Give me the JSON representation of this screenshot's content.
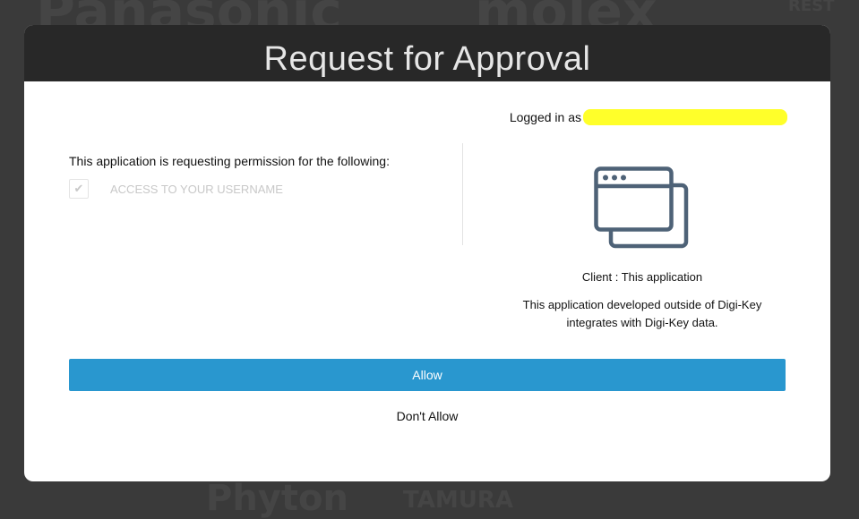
{
  "background_words": [
    "Panasonic",
    "molex",
    "Phyton",
    "TAMURA",
    "REST"
  ],
  "dialog": {
    "title": "Request for Approval",
    "logged_in_label": "Logged in as",
    "permissions_heading": "This application is requesting permission for the following:",
    "permissions": [
      {
        "label": "ACCESS TO YOUR USERNAME",
        "checked": true
      }
    ],
    "client": {
      "icon": "application-windows-icon",
      "line": "Client : This application",
      "description_line1": "This application developed outside of Digi-Key",
      "description_line2": "integrates with Digi-Key data."
    },
    "allow_label": "Allow",
    "deny_label": "Don't Allow"
  },
  "colors": {
    "header_bg": "#282828",
    "allow_button": "#2997cf",
    "redaction": "#ffff2a"
  }
}
